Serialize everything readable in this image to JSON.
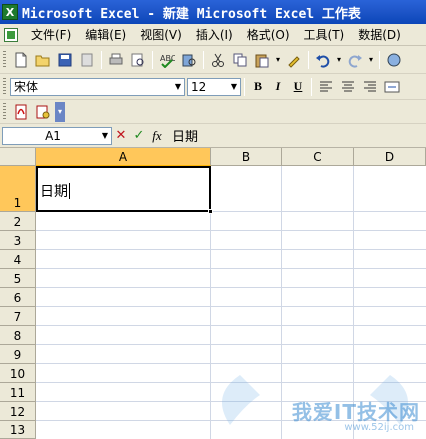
{
  "window": {
    "title": "Microsoft Excel - 新建 Microsoft Excel 工作表",
    "app_icon_letter": "X"
  },
  "menu": {
    "items": [
      "文件(F)",
      "编辑(E)",
      "视图(V)",
      "插入(I)",
      "格式(O)",
      "工具(T)",
      "数据(D)"
    ]
  },
  "format_toolbar": {
    "font_name": "宋体",
    "font_size": "12",
    "bold_label": "B",
    "italic_label": "I",
    "underline_label": "U"
  },
  "formula_bar": {
    "name_box": "A1",
    "cancel_symbol": "✕",
    "enter_symbol": "✓",
    "fx_label": "fx",
    "formula": "日期"
  },
  "sheet": {
    "columns": [
      "A",
      "B",
      "C",
      "D"
    ],
    "rows": [
      "1",
      "2",
      "3",
      "4",
      "5",
      "6",
      "7",
      "8",
      "9",
      "10",
      "11",
      "12",
      "13"
    ],
    "active_cell": "A1",
    "cells": {
      "A1": "日期"
    }
  },
  "watermark": {
    "text": "我爱IT技术网",
    "url": "www.52ij.com"
  },
  "colors": {
    "title_bar": "#1f56c9",
    "chrome": "#ece9d8",
    "active_header": "#ffc75a",
    "grid_line": "#d0d7e5"
  }
}
